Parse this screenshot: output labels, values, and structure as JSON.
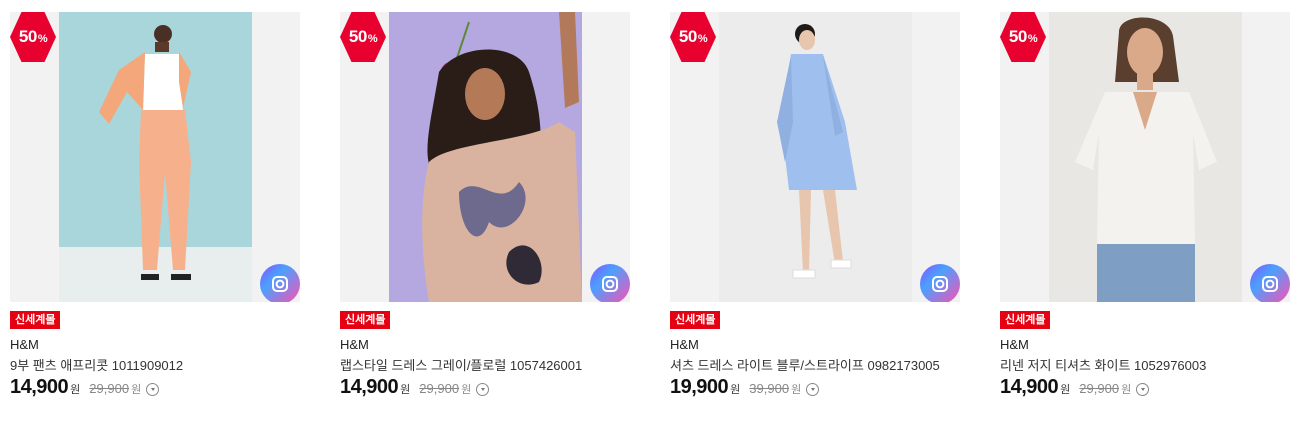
{
  "colors": {
    "badge": "#e8002f",
    "tag": "#e50012"
  },
  "products": [
    {
      "discount": "50",
      "pct": "%",
      "tag": "신세계몰",
      "brand": "H&M",
      "name": "9부 팬츠 애프리콧 1011909012",
      "price": "14,900",
      "won": "원",
      "orig": "29,900",
      "orig_won": "원"
    },
    {
      "discount": "50",
      "pct": "%",
      "tag": "신세계몰",
      "brand": "H&M",
      "name": "랩스타일 드레스 그레이/플로럴 1057426001",
      "price": "14,900",
      "won": "원",
      "orig": "29,900",
      "orig_won": "원"
    },
    {
      "discount": "50",
      "pct": "%",
      "tag": "신세계몰",
      "brand": "H&M",
      "name": "셔츠 드레스 라이트 블루/스트라이프 0982173005",
      "price": "19,900",
      "won": "원",
      "orig": "39,900",
      "orig_won": "원"
    },
    {
      "discount": "50",
      "pct": "%",
      "tag": "신세계몰",
      "brand": "H&M",
      "name": "리넨 저지 티셔츠 화이트 1052976003",
      "price": "14,900",
      "won": "원",
      "orig": "29,900",
      "orig_won": "원"
    }
  ]
}
